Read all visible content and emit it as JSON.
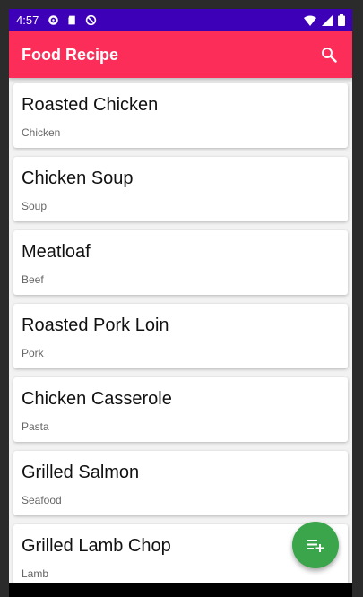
{
  "status_bar": {
    "time": "4:57",
    "bg": "#3d00b8"
  },
  "app_bar": {
    "title": "Food Recipe",
    "bg": "#fc2e59",
    "search_icon": "search-icon"
  },
  "recipes": [
    {
      "title": "Roasted Chicken",
      "category": "Chicken"
    },
    {
      "title": "Chicken Soup",
      "category": "Soup"
    },
    {
      "title": "Meatloaf",
      "category": "Beef"
    },
    {
      "title": "Roasted Pork Loin",
      "category": "Pork"
    },
    {
      "title": "Chicken Casserole",
      "category": "Pasta"
    },
    {
      "title": "Grilled Salmon",
      "category": "Seafood"
    },
    {
      "title": "Grilled Lamb Chop",
      "category": "Lamb"
    }
  ],
  "fab": {
    "icon": "playlist-add-icon",
    "bg": "#3aa54a"
  }
}
